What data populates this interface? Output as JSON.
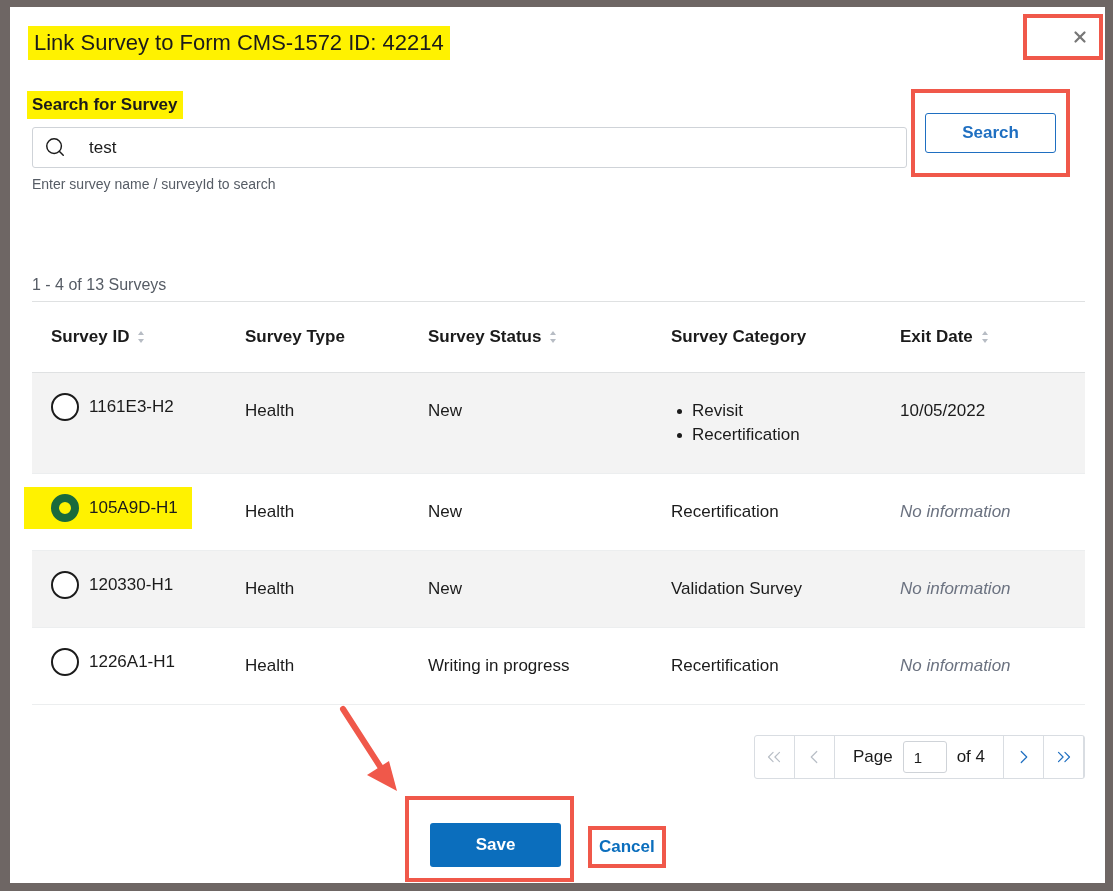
{
  "dialog": {
    "title": "Link Survey to Form CMS-1572 ID: 42214",
    "title_highlighted": true,
    "close_framed": true
  },
  "search": {
    "label": "Search for Survey",
    "label_highlighted": true,
    "value": "test",
    "hint": "Enter survey name / surveyId to search",
    "button": "Search",
    "button_framed": true
  },
  "results_count": "1 - 4 of 13 Surveys",
  "table": {
    "columns": [
      {
        "label": "Survey ID",
        "sortable": true
      },
      {
        "label": "Survey Type",
        "sortable": false
      },
      {
        "label": "Survey Status",
        "sortable": true
      },
      {
        "label": "Survey Category",
        "sortable": false
      },
      {
        "label": "Exit Date",
        "sortable": true
      }
    ],
    "rows": [
      {
        "selected": false,
        "highlighted": false,
        "survey_id": "1161E3-H2",
        "type": "Health",
        "status": "New",
        "category": [
          "Revisit",
          "Recertification"
        ],
        "exit_date": {
          "text": "10/05/2022",
          "kind": "date"
        }
      },
      {
        "selected": true,
        "highlighted": true,
        "survey_id": "105A9D-H1",
        "type": "Health",
        "status": "New",
        "category": [
          "Recertification"
        ],
        "exit_date": {
          "text": "No information",
          "kind": "empty"
        }
      },
      {
        "selected": false,
        "highlighted": false,
        "survey_id": "120330-H1",
        "type": "Health",
        "status": "New",
        "category": [
          "Validation Survey"
        ],
        "exit_date": {
          "text": "No information",
          "kind": "empty"
        }
      },
      {
        "selected": false,
        "highlighted": false,
        "survey_id": "1226A1-H1",
        "type": "Health",
        "status": "Writing in progress",
        "category": [
          "Recertification"
        ],
        "exit_date": {
          "text": "No information",
          "kind": "empty"
        }
      }
    ]
  },
  "pagination": {
    "label": "Page",
    "page": "1",
    "of": "of 4",
    "first_disabled": true,
    "prev_disabled": true,
    "next_disabled": false,
    "last_disabled": false
  },
  "footer": {
    "save": "Save",
    "save_framed": true,
    "save_arrow": true,
    "cancel": "Cancel",
    "cancel_framed": true
  }
}
